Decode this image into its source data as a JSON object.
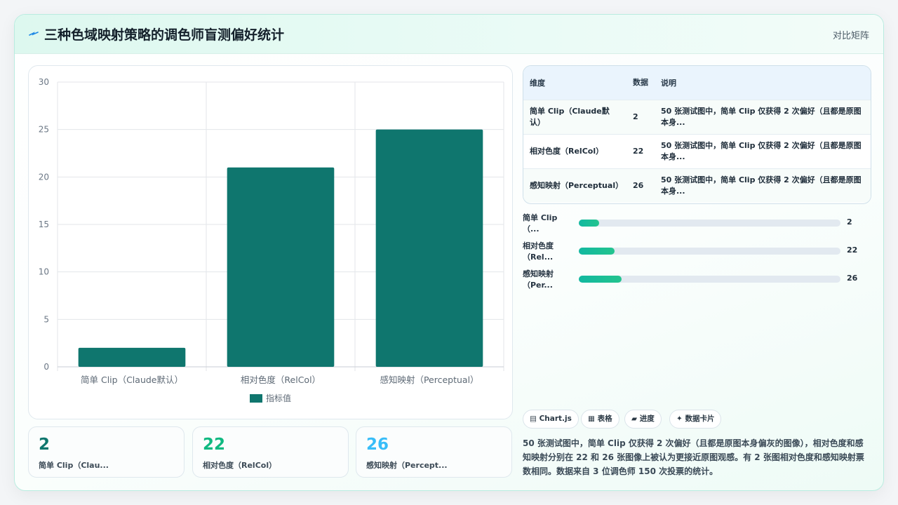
{
  "header": {
    "title": "三种色域映射策略的调色师盲测偏好统计",
    "link": "对比矩阵",
    "icon": "sparkle-arrow-icon"
  },
  "chart_data": {
    "type": "bar",
    "categories": [
      "简单 Clip（Claude默认）",
      "相对色度（RelCol）",
      "感知映射（Perceptual）"
    ],
    "series": [
      {
        "name": "指标值",
        "values": [
          2,
          21,
          25
        ]
      }
    ],
    "ylim": [
      0,
      30
    ],
    "yticks": [
      0,
      5,
      10,
      15,
      20,
      25,
      30
    ],
    "legend": "bottom",
    "grid": true,
    "bar_color": "#0f766e"
  },
  "kpis": [
    {
      "value": "2",
      "label": "简单 Clip（Clau...",
      "color": "#0f766e"
    },
    {
      "value": "22",
      "label": "相对色度（RelCol）",
      "color": "#10b981"
    },
    {
      "value": "26",
      "label": "感知映射（Percept...",
      "color": "#38bdf8"
    }
  ],
  "table": {
    "headers": [
      "维度",
      "数据",
      "说明"
    ],
    "rows": [
      {
        "dim": "简单 Clip（Claude默认）",
        "num": "2",
        "desc": "50 张测试图中，简单 Clip 仅获得 2 次偏好（且都是原图本身..."
      },
      {
        "dim": "相对色度（RelCol）",
        "num": "22",
        "desc": "50 张测试图中，简单 Clip 仅获得 2 次偏好（且都是原图本身..."
      },
      {
        "dim": "感知映射（Perceptual）",
        "num": "26",
        "desc": "50 张测试图中，简单 Clip 仅获得 2 次偏好（且都是原图本身..."
      }
    ]
  },
  "progress": [
    {
      "label": "简单 Clip（...",
      "value": "2",
      "fraction": 0.0769
    },
    {
      "label": "相对色度（Rel...",
      "value": "22",
      "fraction": 0.1365
    },
    {
      "label": "感知映射（Per...",
      "value": "26",
      "fraction": 0.1631
    }
  ],
  "tags": [
    {
      "label": "Chart.js",
      "icon": "bar-chart-icon"
    },
    {
      "label": "表格",
      "icon": "table-icon"
    },
    {
      "label": "进度",
      "icon": "progress-icon"
    },
    {
      "label": "数据卡片",
      "icon": "sparkle-icon"
    }
  ],
  "note": "50 张测试图中，简单 Clip 仅获得 2 次偏好（且都是原图本身偏灰的图像），相对色度和感知映射分别在 22 和 26 张图像上被认为更接近原图观感。有 2 张图相对色度和感知映射票数相同。数据来自 3 位调色师 150 次投票的统计。"
}
